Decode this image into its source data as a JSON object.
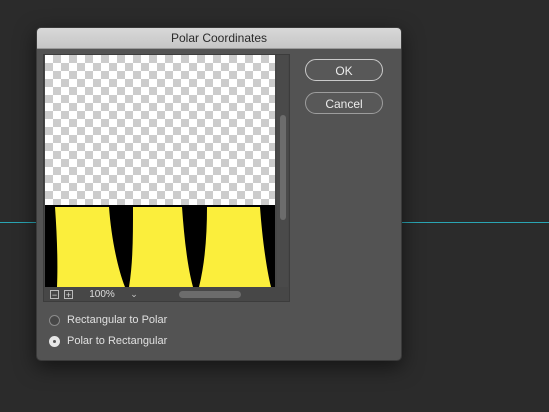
{
  "dialog": {
    "title": "Polar Coordinates",
    "ok_label": "OK",
    "cancel_label": "Cancel"
  },
  "preview": {
    "zoom": "100%",
    "zoom_out_icon": "minus-icon",
    "zoom_in_icon": "plus-icon",
    "dropdown_icon": "chevron-down-icon"
  },
  "options": [
    {
      "label": "Rectangular to Polar",
      "selected": false
    },
    {
      "label": "Polar to Rectangular",
      "selected": true
    }
  ],
  "colors": {
    "accent_yellow": "#fbee3c",
    "guide_line": "#2aa5b3"
  }
}
